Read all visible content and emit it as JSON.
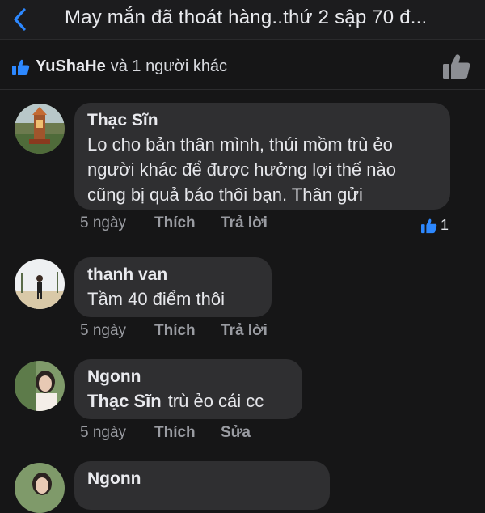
{
  "header": {
    "title": "May mắn đã thoát hàng..thứ 2 sập 70 đ..."
  },
  "likes": {
    "name": "YuShaHe",
    "rest": "và 1 người khác"
  },
  "comments": [
    {
      "author": "Thạc Sĩn",
      "lines": [
        "Lo cho bản thân mình, thúi mồm trù ẻo",
        "người khác để được hưởng lợi thế nào",
        "cũng bị quả báo thôi bạn. Thân gửi"
      ],
      "time": "5 ngày",
      "like_label": "Thích",
      "reply_label": "Trả lời",
      "reaction_count": "1"
    },
    {
      "author": "thanh van",
      "lines": [
        "Tầm 40 điểm thôi"
      ],
      "time": "5 ngày",
      "like_label": "Thích",
      "reply_label": "Trả lời"
    },
    {
      "author": "Ngonn",
      "mention": "Thạc Sĩn",
      "lines": [
        "trù ẻo cái cc"
      ],
      "time": "5 ngày",
      "like_label": "Thích",
      "reply_label": "Sửa"
    },
    {
      "author": "Ngonn"
    }
  ]
}
